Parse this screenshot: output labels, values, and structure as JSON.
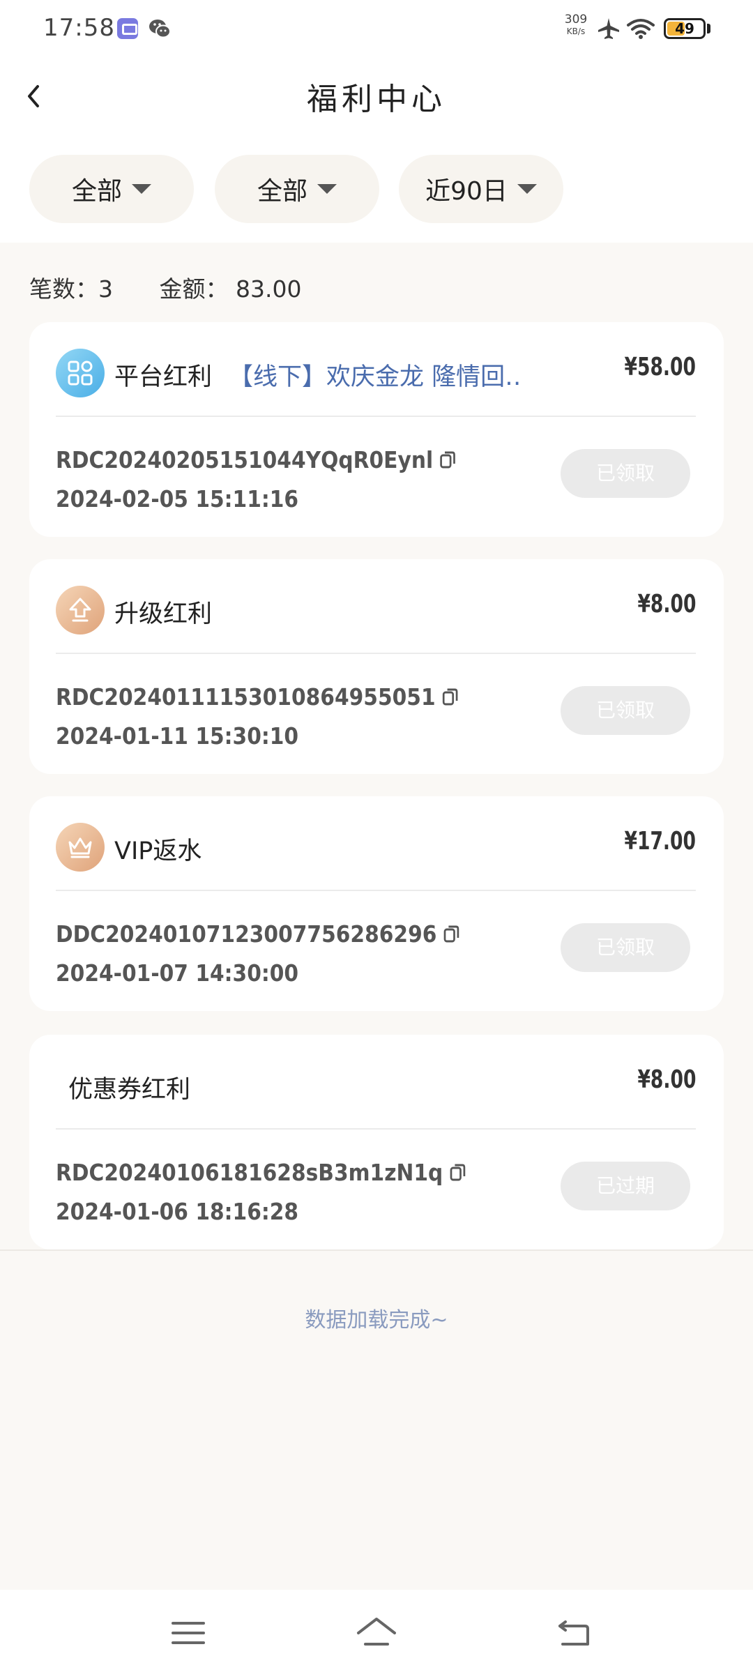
{
  "status_bar": {
    "time": "17:58",
    "net_speed": "309",
    "net_unit": "KB/s",
    "battery": "49",
    "battery_level": 0.49,
    "icons": [
      "app-icon",
      "wechat-icon",
      "airplane-icon",
      "wifi-icon",
      "battery-icon"
    ]
  },
  "header": {
    "title": "福利中心",
    "back_icon": "chevron-left-icon"
  },
  "filters": [
    {
      "label": "全部"
    },
    {
      "label": "全部"
    },
    {
      "label": "近90日"
    }
  ],
  "summary": {
    "count_label": "笔数：3",
    "amount_label": "金额：  83.00"
  },
  "records": [
    {
      "icon": "grid-icon",
      "type": "平台红利",
      "desc": "【线下】欢庆金龙 隆情回…",
      "amount": "¥58.00",
      "id": "RDC20240205151044YQqR0Eynl",
      "datetime": "2024-02-05 15:11:16",
      "status": "已领取"
    },
    {
      "icon": "upgrade-arrow-icon",
      "type": "升级红利",
      "desc": "",
      "amount": "¥8.00",
      "id": "RDC20240111153010864955051",
      "datetime": "2024-01-11 15:30:10",
      "status": "已领取"
    },
    {
      "icon": "crown-icon",
      "type": "VIP返水",
      "desc": "",
      "amount": "¥17.00",
      "id": "DDC20240107123007756286296",
      "datetime": "2024-01-07 14:30:00",
      "status": "已领取"
    },
    {
      "icon": "",
      "type": "优惠券红利",
      "desc": "",
      "amount": "¥8.00",
      "id": "RDC20240106181628sB3m1zN1q",
      "datetime": "2024-01-06 18:16:28",
      "status": "已过期"
    }
  ],
  "footer_text": "数据加载完成~",
  "nav": {
    "icons": [
      "menu-icon",
      "home-icon",
      "back-icon"
    ]
  },
  "colors": {
    "background": "#faf8f5",
    "link_blue": "#4a6cad",
    "status_disabled": "#eaeaea",
    "footer_text": "#8a9bbf"
  }
}
